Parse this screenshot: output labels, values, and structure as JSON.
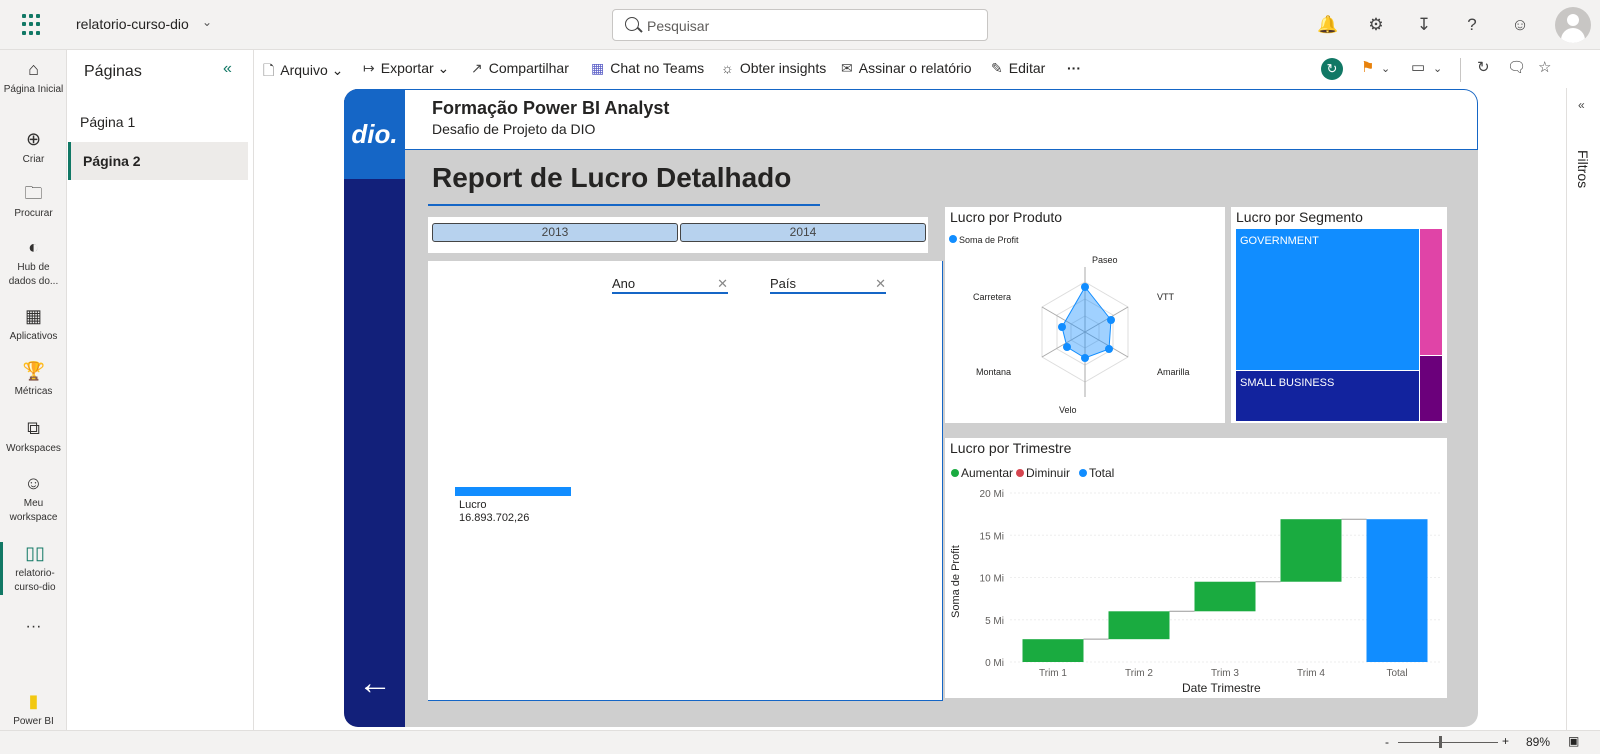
{
  "topbar": {
    "report_name": "relatorio-curso-dio",
    "search_placeholder": "Pesquisar"
  },
  "leftnav": [
    {
      "label": "Página Inicial",
      "icon": "home-icon"
    },
    {
      "label": "Criar",
      "icon": "plus-icon"
    },
    {
      "label": "Procurar",
      "icon": "folder-icon"
    },
    {
      "label": "Hub de dados do...",
      "icon": "data-hub-icon"
    },
    {
      "label": "Aplicativos",
      "icon": "apps-icon"
    },
    {
      "label": "Métricas",
      "icon": "trophy-icon"
    },
    {
      "label": "Workspaces",
      "icon": "workspaces-icon"
    },
    {
      "label": "Meu workspace",
      "icon": "my-workspace-icon"
    },
    {
      "label": "relatorio-curso-dio",
      "icon": "report-icon"
    },
    {
      "label": "Power BI",
      "icon": "powerbi-logo-icon"
    }
  ],
  "pages": {
    "title": "Páginas",
    "items": [
      "Página 1",
      "Página 2"
    ],
    "active": "Página 2"
  },
  "toolbar": {
    "arquivo": "Arquivo",
    "exportar": "Exportar",
    "compartilhar": "Compartilhar",
    "chat": "Chat no Teams",
    "insights": "Obter insights",
    "assinar": "Assinar o relatório",
    "editar": "Editar",
    "more": "···"
  },
  "report": {
    "header_title": "Formação Power BI Analyst",
    "header_subtitle": "Desafio de Projeto da DIO",
    "logo_text": "dio.",
    "page_title": "Report de Lucro Detalhado",
    "years": [
      "2013",
      "2014"
    ],
    "filters": [
      "Ano",
      "País"
    ],
    "lucro_label": "Lucro",
    "lucro_value": "16.893.702,26",
    "radar": {
      "title": "Lucro por Produto",
      "legend": "Soma de Profit",
      "axes": [
        "Paseo",
        "VTT",
        "Amarilla",
        "Velo",
        "Montana",
        "Carretera"
      ]
    },
    "treemap": {
      "title": "Lucro por Segmento",
      "segments": [
        "GOVERNMENT",
        "SMALL BUSINESS"
      ]
    },
    "waterfall": {
      "title": "Lucro por Trimestre",
      "legend": [
        "Aumentar",
        "Diminuir",
        "Total"
      ],
      "ylabel": "Soma de Profit",
      "xlabel": "Date Trimestre",
      "yticks": [
        "20 Mi",
        "15 Mi",
        "10 Mi",
        "5 Mi",
        "0 Mi"
      ]
    }
  },
  "filters_pane": {
    "label": "Filtros"
  },
  "statusbar": {
    "zoom": "89%"
  },
  "colors": {
    "accent": "#117865",
    "navy": "#12207a",
    "blue": "#118dff",
    "green": "#1aab40",
    "red": "#d64550",
    "pink": "#e044a7",
    "purple": "#6b007b"
  },
  "chart_data": {
    "type": "bar",
    "title": "Lucro por Trimestre",
    "xlabel": "Date Trimestre",
    "ylabel": "Soma de Profit",
    "ylim": [
      0,
      20
    ],
    "categories": [
      "Trim 1",
      "Trim 2",
      "Trim 3",
      "Trim 4",
      "Total"
    ],
    "series": [
      {
        "name": "Aumentar",
        "values": [
          2.7,
          3.3,
          3.5,
          7.4,
          null
        ]
      },
      {
        "name": "Total",
        "values": [
          null,
          null,
          null,
          null,
          16.9
        ]
      }
    ],
    "base": [
      0,
      2.7,
      6.0,
      9.5,
      0
    ]
  }
}
